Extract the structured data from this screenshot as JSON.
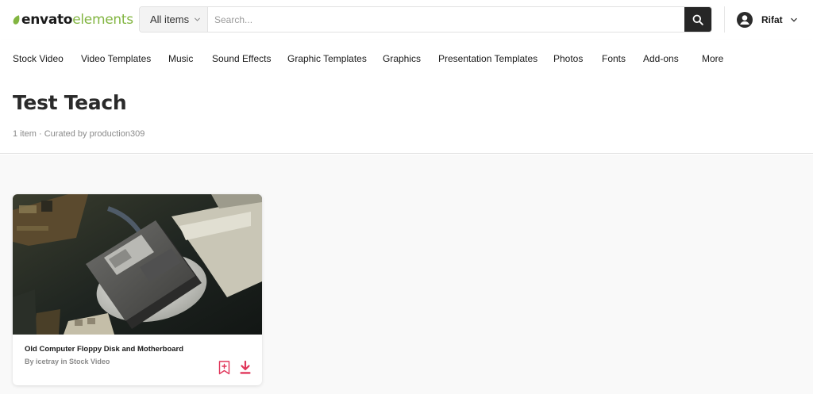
{
  "brand": {
    "name_part1": "envato",
    "name_part2": "elements",
    "accent": "#82b541"
  },
  "search": {
    "scope_label": "All items",
    "placeholder": "Search..."
  },
  "user": {
    "name": "Rifat"
  },
  "nav": {
    "items": [
      "Stock Video",
      "Video Templates",
      "Music",
      "Sound Effects",
      "Graphic Templates",
      "Graphics",
      "Presentation Templates",
      "Photos",
      "Fonts",
      "Add-ons",
      "More"
    ]
  },
  "page": {
    "title": "Test Teach",
    "meta": "1 item · Curated by production309"
  },
  "items": [
    {
      "title": "Old Computer Floppy Disk and Motherboard",
      "author": "By icetray in Stock Video",
      "icons": [
        "bookmark-add-icon",
        "download-icon"
      ],
      "icon_color": "#e0365a"
    }
  ]
}
